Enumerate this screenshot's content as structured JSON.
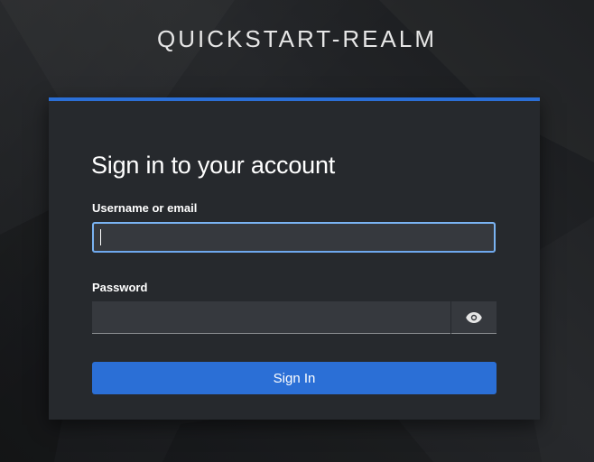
{
  "realm": {
    "title": "QUICKSTART-REALM"
  },
  "login_form": {
    "heading": "Sign in to your account",
    "username": {
      "label": "Username or email",
      "value": "",
      "placeholder": ""
    },
    "password": {
      "label": "Password",
      "value": "",
      "placeholder": ""
    },
    "show_password_icon": "eye-icon",
    "submit_label": "Sign In"
  },
  "colors": {
    "accent": "#2b6fd6",
    "focus_border": "#7ab3f2",
    "card_background": "#26292d",
    "page_background": "#1f2124"
  }
}
